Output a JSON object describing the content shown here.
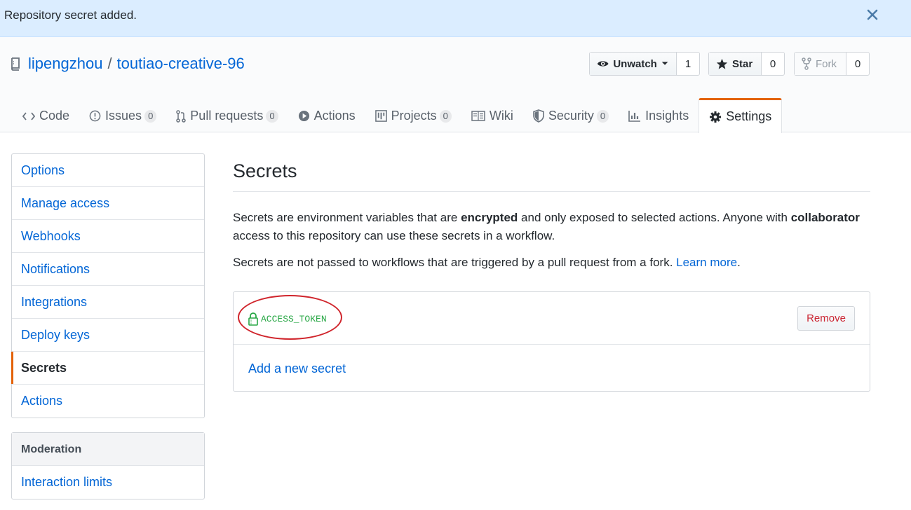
{
  "flash": {
    "message": "Repository secret added."
  },
  "repo": {
    "owner": "lipengzhou",
    "separator": "/",
    "name": "toutiao-creative-96"
  },
  "actions": {
    "watch": {
      "label": "Unwatch",
      "count": "1"
    },
    "star": {
      "label": "Star",
      "count": "0"
    },
    "fork": {
      "label": "Fork",
      "count": "0"
    }
  },
  "tabs": [
    {
      "label": "Code",
      "icon": "code-icon"
    },
    {
      "label": "Issues",
      "counter": "0",
      "icon": "issue-icon"
    },
    {
      "label": "Pull requests",
      "counter": "0",
      "icon": "pull-request-icon"
    },
    {
      "label": "Actions",
      "icon": "play-icon"
    },
    {
      "label": "Projects",
      "counter": "0",
      "icon": "project-icon"
    },
    {
      "label": "Wiki",
      "icon": "book-icon"
    },
    {
      "label": "Security",
      "counter": "0",
      "icon": "shield-icon"
    },
    {
      "label": "Insights",
      "icon": "graph-icon"
    },
    {
      "label": "Settings",
      "icon": "gear-icon",
      "selected": true
    }
  ],
  "sidebar": {
    "items": [
      "Options",
      "Manage access",
      "Webhooks",
      "Notifications",
      "Integrations",
      "Deploy keys",
      "Secrets",
      "Actions"
    ],
    "selected": "Secrets",
    "moderation": {
      "heading": "Moderation",
      "items": [
        "Interaction limits"
      ]
    }
  },
  "main": {
    "title": "Secrets",
    "description": {
      "part1": "Secrets are environment variables that are ",
      "bold1": "encrypted",
      "part2": " and only exposed to selected actions. Anyone with ",
      "bold2": "collaborator",
      "part3": " access to this repository can use these secrets in a workflow."
    },
    "note": {
      "text": "Secrets are not passed to workflows that are triggered by a pull request from a fork. ",
      "link": "Learn more",
      "end": "."
    },
    "secrets": [
      {
        "name": "ACCESS_TOKEN",
        "remove_label": "Remove"
      }
    ],
    "add_label": "Add a new secret"
  },
  "colors": {
    "accent_orange": "#e36209",
    "link_blue": "#0366d6",
    "secret_green": "#28a745",
    "danger_red": "#cb2431",
    "annotation_red": "#d0252c",
    "flash_bg": "#dbedff"
  }
}
